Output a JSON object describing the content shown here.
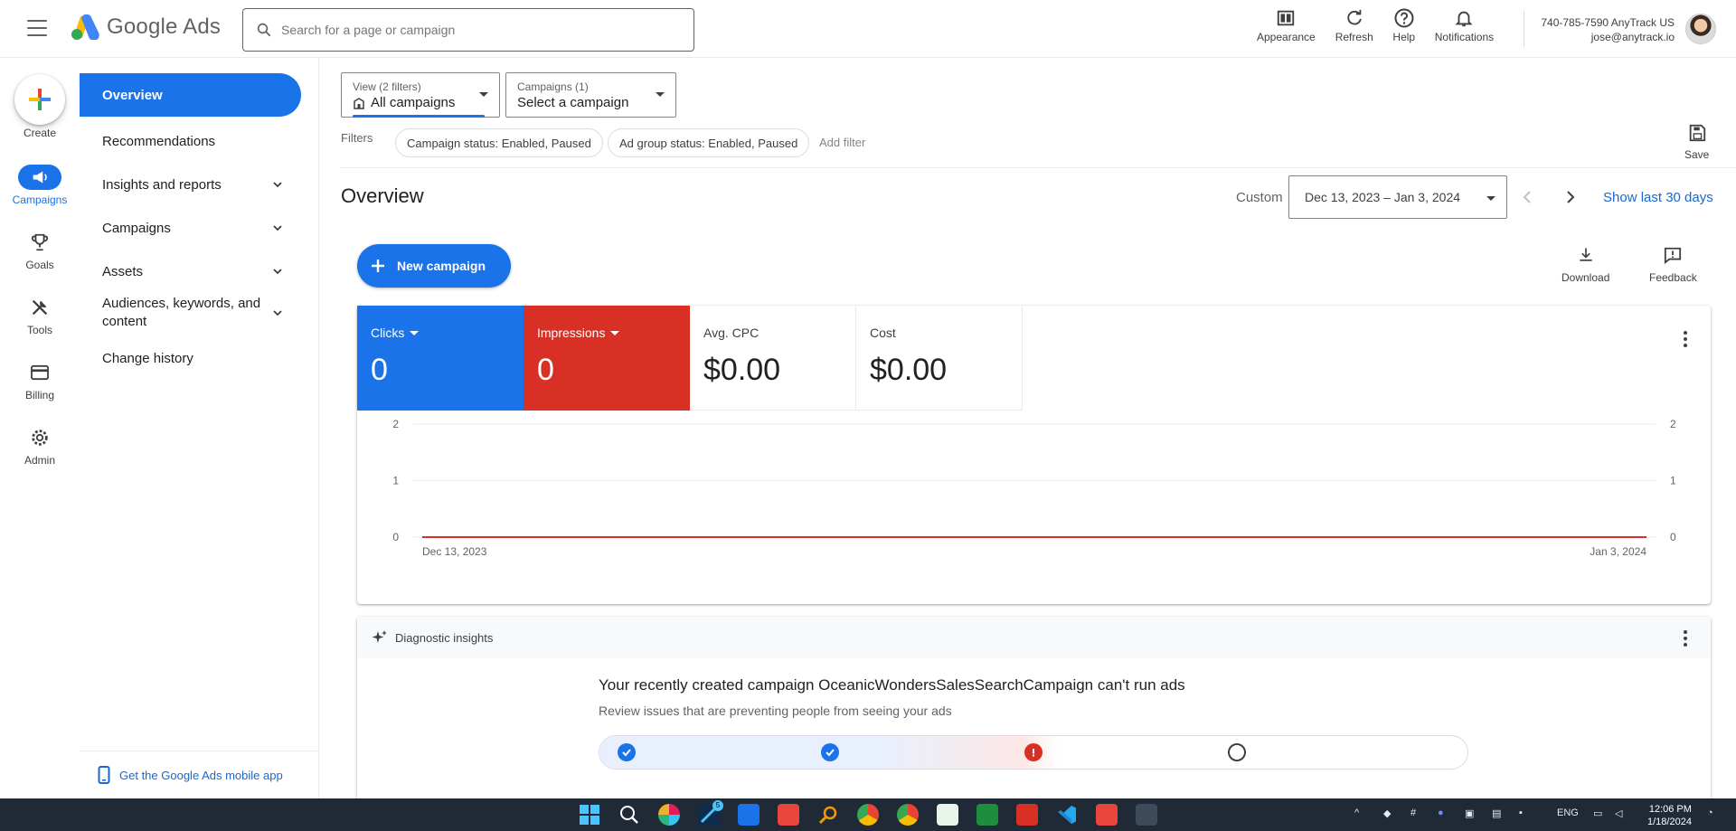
{
  "app": {
    "name": "Google Ads"
  },
  "search": {
    "placeholder": "Search for a page or campaign"
  },
  "top_actions": {
    "appearance": "Appearance",
    "refresh": "Refresh",
    "help": "Help",
    "notifications": "Notifications"
  },
  "account": {
    "phone_line": "740-785-7590 AnyTrack US",
    "email": "jose@anytrack.io"
  },
  "rail": {
    "create": "Create",
    "campaigns": "Campaigns",
    "goals": "Goals",
    "tools": "Tools",
    "billing": "Billing",
    "admin": "Admin"
  },
  "nav": {
    "overview": "Overview",
    "recommendations": "Recommendations",
    "insights": "Insights and reports",
    "campaigns": "Campaigns",
    "assets": "Assets",
    "audiences": "Audiences, keywords, and content",
    "change_history": "Change history",
    "mobile_app": "Get the Google Ads mobile app"
  },
  "view_selector": {
    "label": "View (2 filters)",
    "value": "All campaigns"
  },
  "campaign_selector": {
    "label": "Campaigns (1)",
    "value": "Select a campaign"
  },
  "filters": {
    "label": "Filters",
    "chip1": "Campaign status: Enabled, Paused",
    "chip2": "Ad group status: Enabled, Paused",
    "add": "Add filter"
  },
  "save": "Save",
  "page_title": "Overview",
  "date": {
    "custom": "Custom",
    "range": "Dec 13, 2023 – Jan 3, 2024",
    "show_last": "Show last 30 days"
  },
  "new_campaign": "New campaign",
  "download": "Download",
  "feedback": "Feedback",
  "metrics": {
    "clicks": {
      "label": "Clicks",
      "value": "0"
    },
    "impressions": {
      "label": "Impressions",
      "value": "0"
    },
    "avg_cpc": {
      "label": "Avg. CPC",
      "value": "$0.00"
    },
    "cost": {
      "label": "Cost",
      "value": "$0.00"
    }
  },
  "chart_data": {
    "type": "line",
    "x": [
      "Dec 13, 2023",
      "Jan 3, 2024"
    ],
    "series": [
      {
        "name": "Clicks",
        "values": [
          0,
          0
        ],
        "color": "#1a73e8"
      },
      {
        "name": "Impressions",
        "values": [
          0,
          0
        ],
        "color": "#d93025"
      }
    ],
    "y_left_ticks": [
      "0",
      "1",
      "2"
    ],
    "y_right_ticks": [
      "0",
      "1",
      "2"
    ],
    "ylim": [
      0,
      2
    ],
    "grid": true
  },
  "diagnostic": {
    "header": "Diagnostic insights",
    "title": "Your recently created campaign OceanicWondersSalesSearchCampaign can't run ads",
    "subtitle": "Review issues that are preventing people from seeing your ads",
    "progress": 0.53
  },
  "taskbar": {
    "language": "ENG",
    "time": "12:06 PM",
    "date": "1/18/2024",
    "badge1": "5"
  },
  "colors": {
    "accent": "#1a73e8",
    "error": "#d93025",
    "taskbar": "#1f2a36"
  }
}
